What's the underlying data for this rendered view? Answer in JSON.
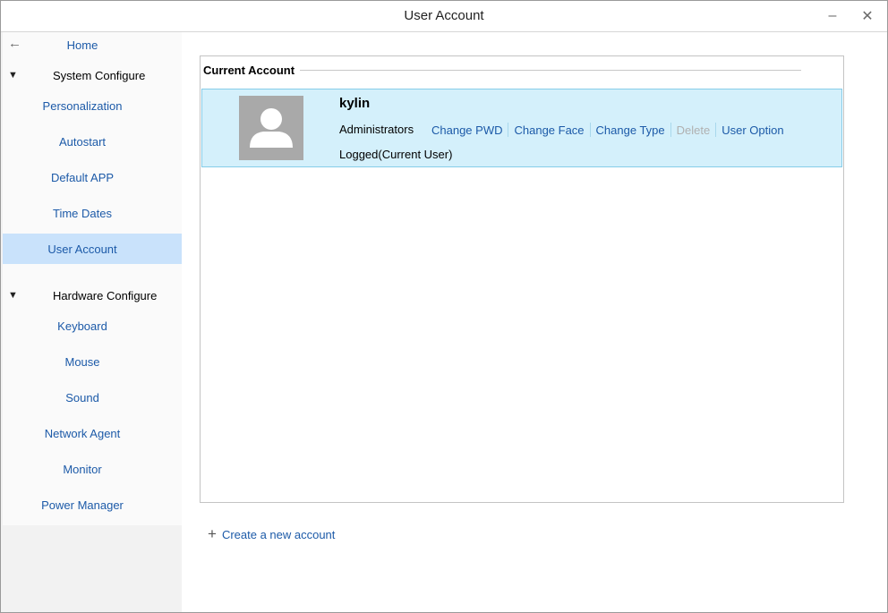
{
  "window": {
    "title": "User Account",
    "minimize_glyph": "–",
    "close_glyph": "✕"
  },
  "sidebar": {
    "back_icon": "←",
    "home": "Home",
    "groups": [
      {
        "label": "System Configure",
        "toggle": "▼",
        "items": [
          "Personalization",
          "Autostart",
          "Default APP",
          "Time Dates",
          "User Account"
        ]
      },
      {
        "label": "Hardware Configure",
        "toggle": "▼",
        "items": [
          "Keyboard",
          "Mouse",
          "Sound",
          "Network Agent",
          "Monitor",
          "Power Manager"
        ]
      }
    ],
    "active_item": "User Account"
  },
  "main": {
    "section_title": "Current Account",
    "account": {
      "username": "kylin",
      "type": "Administrators",
      "actions": {
        "change_pwd": "Change PWD",
        "change_face": "Change Face",
        "change_type": "Change Type",
        "delete": "Delete",
        "user_option": "User Option"
      },
      "status": "Logged(Current User)"
    },
    "create_account": "Create a new account",
    "plus_icon": "+"
  },
  "colors": {
    "link": "#1c5aa8",
    "active_nav_bg": "#c9e2fb",
    "account_row_bg": "#d4f0fb",
    "account_row_border": "#86cde9",
    "avatar_bg": "#a9a9a9",
    "disabled": "#b0b0b0"
  }
}
